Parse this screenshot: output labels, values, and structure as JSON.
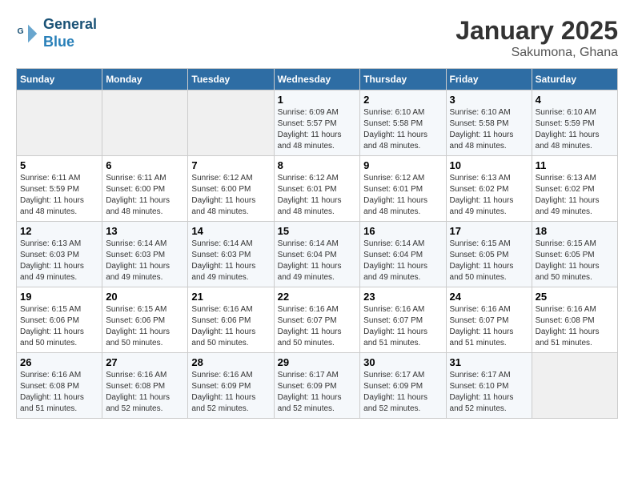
{
  "logo": {
    "line1": "General",
    "line2": "Blue"
  },
  "title": "January 2025",
  "subtitle": "Sakumona, Ghana",
  "days_of_week": [
    "Sunday",
    "Monday",
    "Tuesday",
    "Wednesday",
    "Thursday",
    "Friday",
    "Saturday"
  ],
  "weeks": [
    [
      {
        "num": "",
        "info": ""
      },
      {
        "num": "",
        "info": ""
      },
      {
        "num": "",
        "info": ""
      },
      {
        "num": "1",
        "info": "Sunrise: 6:09 AM\nSunset: 5:57 PM\nDaylight: 11 hours and 48 minutes."
      },
      {
        "num": "2",
        "info": "Sunrise: 6:10 AM\nSunset: 5:58 PM\nDaylight: 11 hours and 48 minutes."
      },
      {
        "num": "3",
        "info": "Sunrise: 6:10 AM\nSunset: 5:58 PM\nDaylight: 11 hours and 48 minutes."
      },
      {
        "num": "4",
        "info": "Sunrise: 6:10 AM\nSunset: 5:59 PM\nDaylight: 11 hours and 48 minutes."
      }
    ],
    [
      {
        "num": "5",
        "info": "Sunrise: 6:11 AM\nSunset: 5:59 PM\nDaylight: 11 hours and 48 minutes."
      },
      {
        "num": "6",
        "info": "Sunrise: 6:11 AM\nSunset: 6:00 PM\nDaylight: 11 hours and 48 minutes."
      },
      {
        "num": "7",
        "info": "Sunrise: 6:12 AM\nSunset: 6:00 PM\nDaylight: 11 hours and 48 minutes."
      },
      {
        "num": "8",
        "info": "Sunrise: 6:12 AM\nSunset: 6:01 PM\nDaylight: 11 hours and 48 minutes."
      },
      {
        "num": "9",
        "info": "Sunrise: 6:12 AM\nSunset: 6:01 PM\nDaylight: 11 hours and 48 minutes."
      },
      {
        "num": "10",
        "info": "Sunrise: 6:13 AM\nSunset: 6:02 PM\nDaylight: 11 hours and 49 minutes."
      },
      {
        "num": "11",
        "info": "Sunrise: 6:13 AM\nSunset: 6:02 PM\nDaylight: 11 hours and 49 minutes."
      }
    ],
    [
      {
        "num": "12",
        "info": "Sunrise: 6:13 AM\nSunset: 6:03 PM\nDaylight: 11 hours and 49 minutes."
      },
      {
        "num": "13",
        "info": "Sunrise: 6:14 AM\nSunset: 6:03 PM\nDaylight: 11 hours and 49 minutes."
      },
      {
        "num": "14",
        "info": "Sunrise: 6:14 AM\nSunset: 6:03 PM\nDaylight: 11 hours and 49 minutes."
      },
      {
        "num": "15",
        "info": "Sunrise: 6:14 AM\nSunset: 6:04 PM\nDaylight: 11 hours and 49 minutes."
      },
      {
        "num": "16",
        "info": "Sunrise: 6:14 AM\nSunset: 6:04 PM\nDaylight: 11 hours and 49 minutes."
      },
      {
        "num": "17",
        "info": "Sunrise: 6:15 AM\nSunset: 6:05 PM\nDaylight: 11 hours and 50 minutes."
      },
      {
        "num": "18",
        "info": "Sunrise: 6:15 AM\nSunset: 6:05 PM\nDaylight: 11 hours and 50 minutes."
      }
    ],
    [
      {
        "num": "19",
        "info": "Sunrise: 6:15 AM\nSunset: 6:06 PM\nDaylight: 11 hours and 50 minutes."
      },
      {
        "num": "20",
        "info": "Sunrise: 6:15 AM\nSunset: 6:06 PM\nDaylight: 11 hours and 50 minutes."
      },
      {
        "num": "21",
        "info": "Sunrise: 6:16 AM\nSunset: 6:06 PM\nDaylight: 11 hours and 50 minutes."
      },
      {
        "num": "22",
        "info": "Sunrise: 6:16 AM\nSunset: 6:07 PM\nDaylight: 11 hours and 50 minutes."
      },
      {
        "num": "23",
        "info": "Sunrise: 6:16 AM\nSunset: 6:07 PM\nDaylight: 11 hours and 51 minutes."
      },
      {
        "num": "24",
        "info": "Sunrise: 6:16 AM\nSunset: 6:07 PM\nDaylight: 11 hours and 51 minutes."
      },
      {
        "num": "25",
        "info": "Sunrise: 6:16 AM\nSunset: 6:08 PM\nDaylight: 11 hours and 51 minutes."
      }
    ],
    [
      {
        "num": "26",
        "info": "Sunrise: 6:16 AM\nSunset: 6:08 PM\nDaylight: 11 hours and 51 minutes."
      },
      {
        "num": "27",
        "info": "Sunrise: 6:16 AM\nSunset: 6:08 PM\nDaylight: 11 hours and 52 minutes."
      },
      {
        "num": "28",
        "info": "Sunrise: 6:16 AM\nSunset: 6:09 PM\nDaylight: 11 hours and 52 minutes."
      },
      {
        "num": "29",
        "info": "Sunrise: 6:17 AM\nSunset: 6:09 PM\nDaylight: 11 hours and 52 minutes."
      },
      {
        "num": "30",
        "info": "Sunrise: 6:17 AM\nSunset: 6:09 PM\nDaylight: 11 hours and 52 minutes."
      },
      {
        "num": "31",
        "info": "Sunrise: 6:17 AM\nSunset: 6:10 PM\nDaylight: 11 hours and 52 minutes."
      },
      {
        "num": "",
        "info": ""
      }
    ]
  ]
}
